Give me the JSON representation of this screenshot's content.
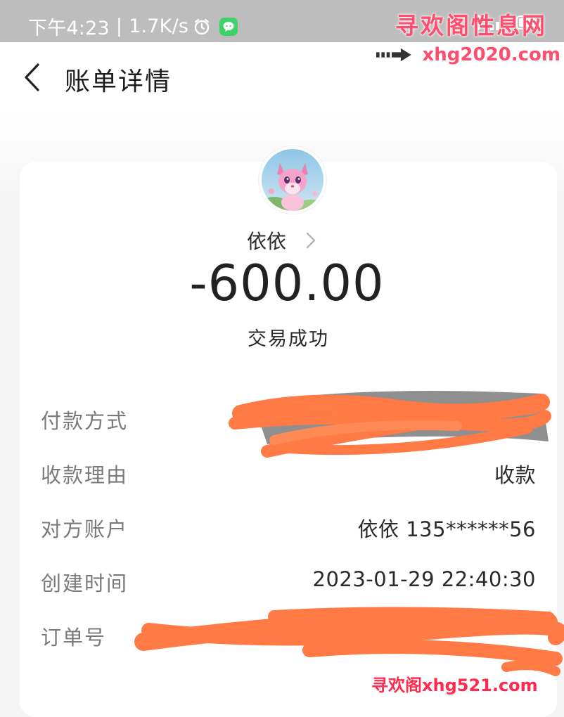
{
  "status_bar": {
    "time": "下午4:23",
    "separator": "|",
    "net_speed": "1.7K/s"
  },
  "watermarks": {
    "top": "寻欢阁性息网",
    "url": "xhg2020.com",
    "bottom": "寻欢阁xhg521.com"
  },
  "header": {
    "title": "账单详情"
  },
  "payee": {
    "name": "依依",
    "amount": "-600.00",
    "status": "交易成功"
  },
  "details": {
    "payment_method": {
      "label": "付款方式",
      "value": ""
    },
    "reason": {
      "label": "收款理由",
      "value": "收款"
    },
    "counterparty": {
      "label": "对方账户",
      "value": "依依 135******56"
    },
    "created_time": {
      "label": "创建时间",
      "value": "2023-01-29 22:40:30"
    },
    "order_no": {
      "label": "订单号",
      "value": ""
    }
  },
  "colors": {
    "redaction": "#ff7a45",
    "watermark": "#ff4d6d",
    "wechat_green": "#3ed36a"
  }
}
